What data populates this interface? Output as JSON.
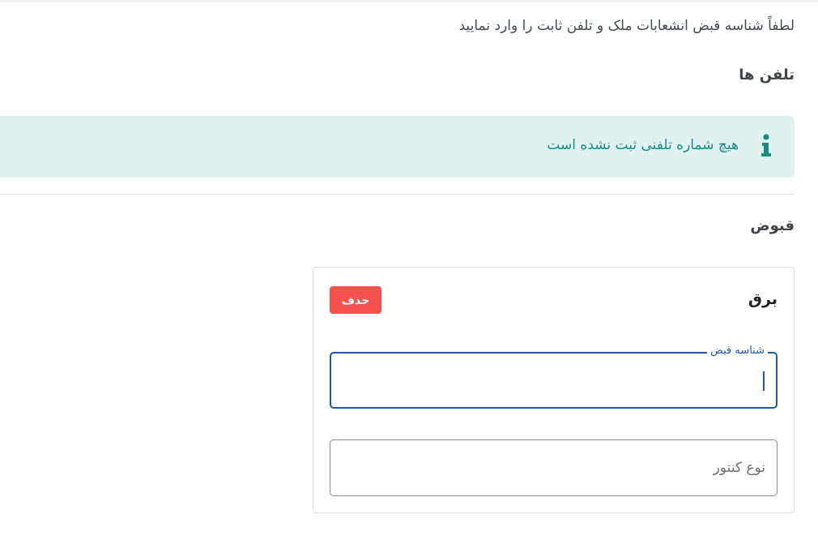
{
  "instruction_text": "لطفاً شناسه قبض انشعابات ملک و تلفن ثابت را وارد نمایید",
  "phones": {
    "title": "تلفن ها",
    "empty_message": "هیچ شماره تلفنی ثبت نشده است",
    "icon": "info-icon"
  },
  "bills": {
    "title": "قبوض",
    "items": [
      {
        "title": "برق",
        "delete_label": "حذف",
        "bill_id_label": "شناسه قبض",
        "bill_id_value": "",
        "meter_type_placeholder": "نوع کنتور"
      }
    ]
  },
  "colors": {
    "alert_bg": "#e0f2ef",
    "alert_text": "#1a8a83",
    "danger": "#f5514f",
    "focus": "#1e5aa6"
  }
}
